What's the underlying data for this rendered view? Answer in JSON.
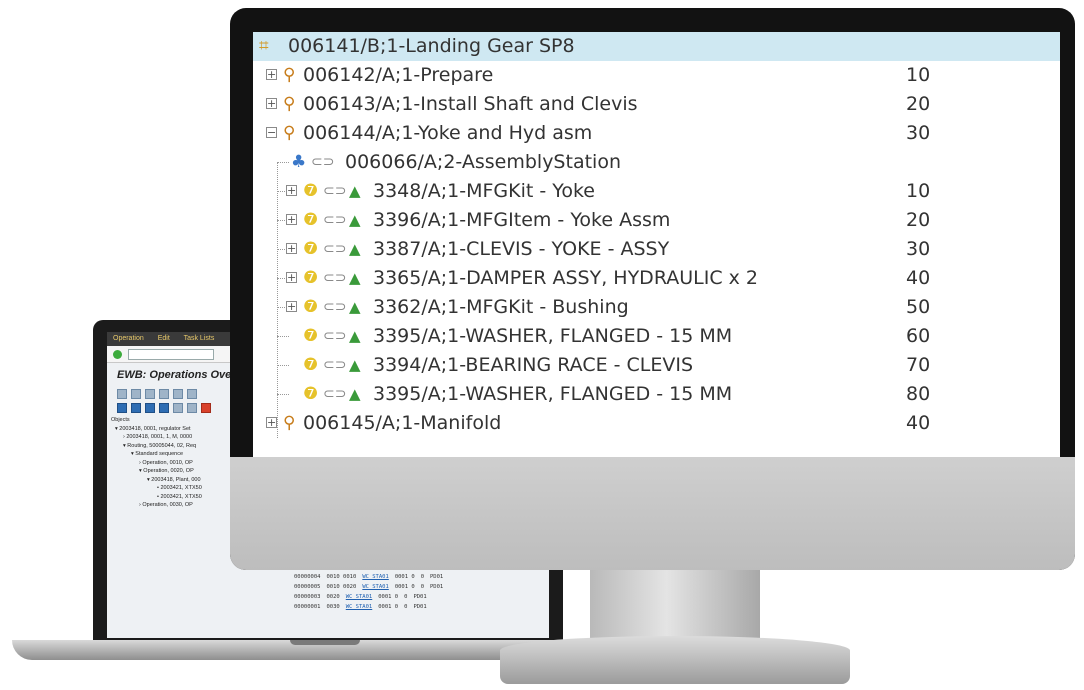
{
  "laptop": {
    "menu": [
      "Operation",
      "Edit",
      "Task Lists"
    ],
    "command_field": "",
    "screen_title": "EWB: Operations Ove",
    "tree_header": "Objects",
    "tree_rows": [
      "2003418, 0001, regulator Set",
      "2003418, 0001, 1, M, 0000",
      "Routing, 50005044, 02, Req",
      "Standard sequence",
      "Operation, 0010, OP",
      "Operation, 0020, OP",
      "2003418, Plant, 000",
      "2003421, XTX50",
      "2003421, XTX50",
      "Operation, 0030, OP"
    ],
    "table_rows": [
      {
        "c1": "00000004",
        "c2": "0010 0010",
        "c3": "WC_STA01",
        "c4": "0001 0",
        "c5": "0",
        "c6": "PD01"
      },
      {
        "c1": "00000005",
        "c2": "0010 0020",
        "c3": "WC_STA01",
        "c4": "0001 0",
        "c5": "0",
        "c6": "PD01"
      },
      {
        "c1": "00000003",
        "c2": "0020",
        "c3": "WC_STA01",
        "c4": "0001 0",
        "c5": "0",
        "c6": "PD01"
      },
      {
        "c1": "00000001",
        "c2": "0030",
        "c3": "WC_STA01",
        "c4": "0001 0",
        "c5": "0",
        "c6": "PD01"
      }
    ]
  },
  "monitor": {
    "root": {
      "label": "006141/B;1-Landing Gear SP8",
      "icon": "routing-icon"
    },
    "operations": [
      {
        "label": "006142/A;1-Prepare",
        "number": "10",
        "expanded": false
      },
      {
        "label": "006143/A;1-Install Shaft and Clevis",
        "number": "20",
        "expanded": false
      },
      {
        "label": "006144/A;1-Yoke and Hyd asm",
        "number": "30",
        "expanded": true
      },
      {
        "label": "006145/A;1-Manifold",
        "number": "40",
        "expanded": false
      }
    ],
    "station": {
      "label": "006066/A;2-AssemblyStation"
    },
    "parts": [
      {
        "label": "3348/A;1-MFGKit - Yoke",
        "number": "10",
        "expandable": true
      },
      {
        "label": "3396/A;1-MFGItem - Yoke Assm",
        "number": "20",
        "expandable": true
      },
      {
        "label": "3387/A;1-CLEVIS - YOKE - ASSY",
        "number": "30",
        "expandable": true
      },
      {
        "label": "3365/A;1-DAMPER ASSY, HYDRAULIC x 2",
        "number": "40",
        "expandable": true
      },
      {
        "label": "3362/A;1-MFGKit - Bushing",
        "number": "50",
        "expandable": true
      },
      {
        "label": "3395/A;1-WASHER, FLANGED - 15 MM",
        "number": "60",
        "expandable": false
      },
      {
        "label": "3394/A;1-BEARING RACE - CLEVIS",
        "number": "70",
        "expandable": false
      },
      {
        "label": "3395/A;1-WASHER, FLANGED - 15 MM",
        "number": "80",
        "expandable": false
      }
    ],
    "colors": {
      "selection": "#cfe8f2",
      "frame": "#121212",
      "text": "#333333"
    }
  }
}
